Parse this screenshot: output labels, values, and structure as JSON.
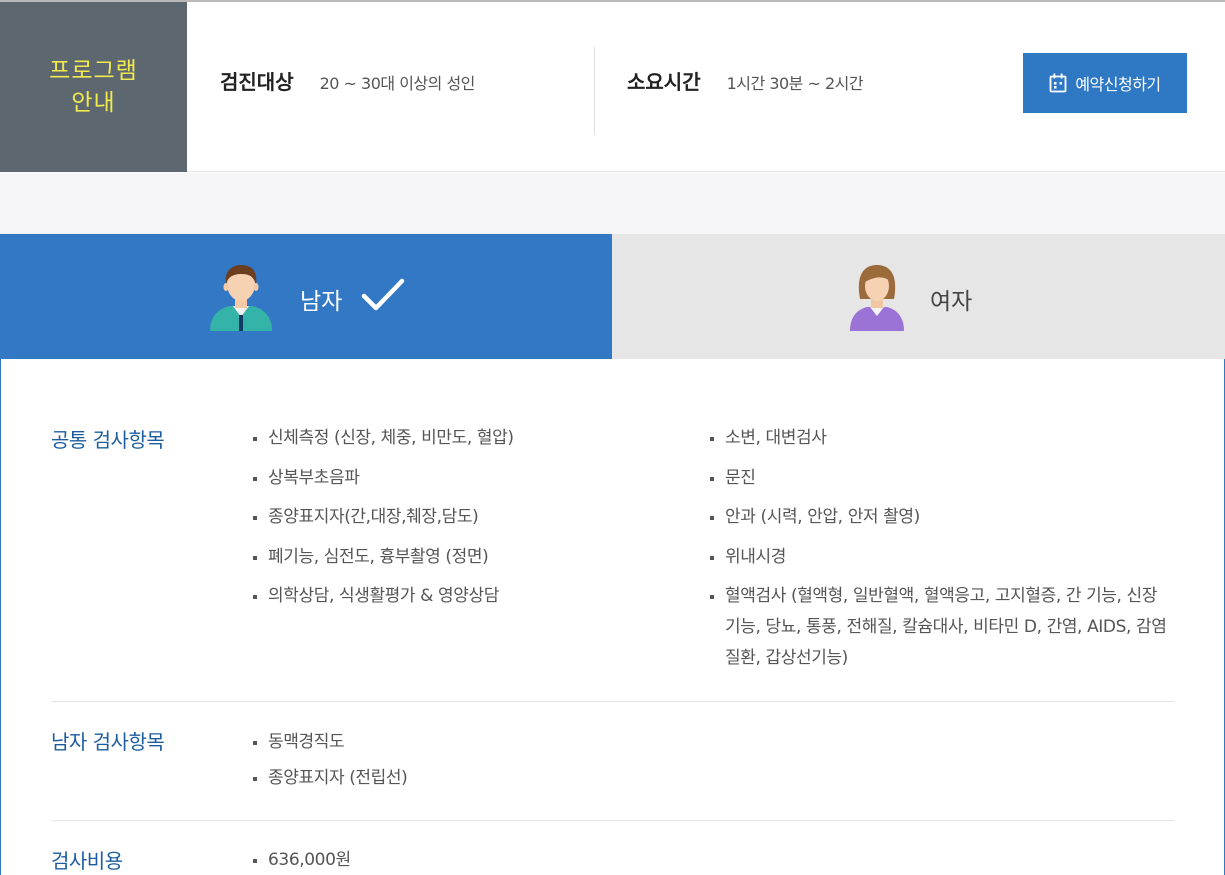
{
  "program": {
    "label": "프로그램\n안내",
    "target_key": "검진대상",
    "target_value": "20 ~ 30대 이상의 성인",
    "duration_key": "소요시간",
    "duration_value": "1시간 30분 ~ 2시간",
    "reserve_button": "예약신청하기"
  },
  "tabs": {
    "male": "남자",
    "female": "여자",
    "selected": "male"
  },
  "sections": {
    "common": {
      "title": "공통 검사항목",
      "left": [
        "신체측정 (신장, 체중, 비만도, 혈압)",
        "상복부초음파",
        "종양표지자(간,대장,췌장,담도)",
        "폐기능, 심전도, 흉부촬영 (정면)",
        "의학상담, 식생활평가 & 영양상담"
      ],
      "right": [
        "소변, 대변검사",
        "문진",
        "안과 (시력, 안압, 안저 촬영)",
        "위내시경",
        "혈액검사 (혈액형, 일반혈액, 혈액응고, 고지혈증, 간 기능, 신장기능, 당뇨, 통풍, 전해질, 칼슘대사, 비타민 D, 간염, AIDS, 감염질환, 갑상선기능)"
      ]
    },
    "male": {
      "title": "남자 검사항목",
      "items": [
        "동맥경직도",
        "종양표지자 (전립선)"
      ]
    },
    "cost": {
      "title": "검사비용",
      "items": [
        "636,000원"
      ]
    }
  },
  "colors": {
    "accent": "#3278c4",
    "label_bg": "#5d6770",
    "label_text": "#f2e94e",
    "section_title": "#1d5d9f"
  }
}
